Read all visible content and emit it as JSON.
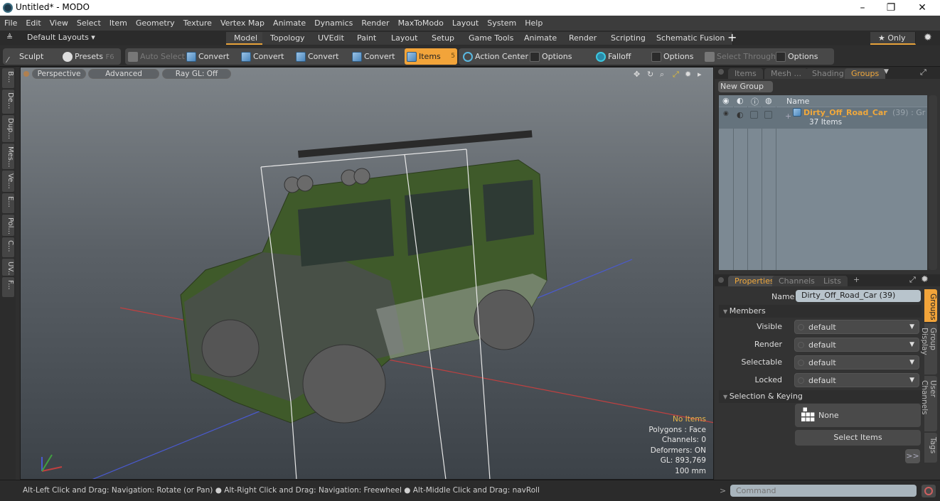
{
  "window": {
    "title": "Untitled* - MODO",
    "minimize": "–",
    "restore": "❐",
    "close": "✕"
  },
  "menu": [
    "File",
    "Edit",
    "View",
    "Select",
    "Item",
    "Geometry",
    "Texture",
    "Vertex Map",
    "Animate",
    "Dynamics",
    "Render",
    "MaxToModo",
    "Layout",
    "System",
    "Help"
  ],
  "layouts": {
    "selector": "Default Layouts ▾",
    "tabs": [
      "Model",
      "Topology",
      "UVEdit",
      "Paint",
      "Layout",
      "Setup",
      "Game Tools",
      "Animate",
      "Render",
      "Scripting",
      "Schematic Fusion"
    ],
    "active": "Model",
    "add": "+",
    "only": "★ Only"
  },
  "toolbar": {
    "sculpt": "Sculpt",
    "presets": "Presets",
    "presets_key": "F6",
    "auto_select": "Auto Select",
    "convert1": "Convert",
    "convert2": "Convert",
    "convert3": "Convert",
    "convert4": "Convert",
    "items": "Items",
    "items_key": "5",
    "action_center": "Action Center",
    "options1": "Options",
    "falloff": "Falloff",
    "options2": "Options",
    "select_through": "Select Through",
    "options3": "Options"
  },
  "left_tabs": [
    "B...",
    "De...",
    "Dup...",
    "Mes...",
    "Ve...",
    "E...",
    "Pol...",
    "C...",
    "UV...",
    "F..."
  ],
  "viewport": {
    "view": "Perspective",
    "shading": "Advanced",
    "raygl": "Ray GL: Off",
    "hud": {
      "selection": "No Items",
      "polygons": "Polygons : Face",
      "channels": "Channels: 0",
      "deformers": "Deformers: ON",
      "gl": "GL: 893,769",
      "scale": "100 mm"
    }
  },
  "status": "Alt-Left Click and Drag: Navigation: Rotate (or Pan) ● Alt-Right Click and Drag: Navigation: Freewheel ● Alt-Middle Click and Drag: navRoll",
  "top_panel": {
    "tabs": [
      "Items",
      "Mesh ...",
      "Shading",
      "Groups"
    ],
    "active": "Groups",
    "new_group": "New Group",
    "col_name": "Name",
    "group": {
      "name": "Dirty_Off_Road_Car",
      "suffix": "(39) : Gr ...",
      "count": "37 Items"
    }
  },
  "properties": {
    "tabs": [
      "Properties",
      "Channels",
      "Lists"
    ],
    "active": "Properties",
    "add": "+",
    "name_label": "Name",
    "name_value": "Dirty_Off_Road_Car (39)",
    "members_section": "Members",
    "rows": [
      {
        "label": "Visible",
        "value": "default"
      },
      {
        "label": "Render",
        "value": "default"
      },
      {
        "label": "Selectable",
        "value": "default"
      },
      {
        "label": "Locked",
        "value": "default"
      }
    ],
    "selection_section": "Selection & Keying",
    "none_label": "None",
    "select_items": "Select Items",
    "more": ">>",
    "side_tabs": [
      "Groups",
      "Group Display",
      "User Channels",
      "Tags"
    ]
  },
  "command": {
    "prompt": ">",
    "placeholder": "Command"
  },
  "colors": {
    "accent": "#f2a43a",
    "group_name": "#f0a83c"
  }
}
